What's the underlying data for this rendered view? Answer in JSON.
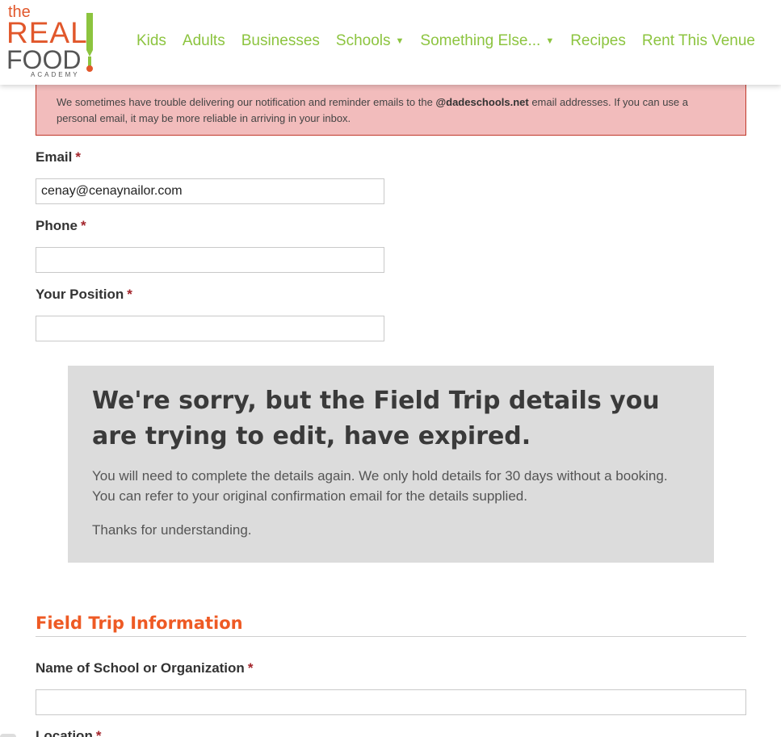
{
  "header": {
    "logo": {
      "the": "the",
      "real": "REAL",
      "food": "FOOD",
      "academy": "ACADEMY"
    },
    "nav": [
      {
        "label": "Kids",
        "dropdown": false
      },
      {
        "label": "Adults",
        "dropdown": false
      },
      {
        "label": "Businesses",
        "dropdown": false
      },
      {
        "label": "Schools",
        "dropdown": true
      },
      {
        "label": "Something Else...",
        "dropdown": true
      },
      {
        "label": "Recipes",
        "dropdown": false
      },
      {
        "label": "Rent This Venue",
        "dropdown": false
      }
    ],
    "nav_color": "#8cc43f"
  },
  "alert": {
    "text_before": "We sometimes have trouble delivering our notification and reminder emails to the ",
    "domain": "@dadeschools.net",
    "text_after": " email addresses. If you can use a personal email, it may be more reliable in arriving in your inbox."
  },
  "form": {
    "email": {
      "label": "Email",
      "required": "*",
      "value": "cenay@cenaynailor.com"
    },
    "phone": {
      "label": "Phone",
      "required": "*",
      "value": ""
    },
    "position": {
      "label": "Your Position",
      "required": "*",
      "value": ""
    }
  },
  "notice": {
    "heading": "We're sorry, but the Field Trip details you are trying to edit, have expired.",
    "body": "You will need to complete the details again. We only hold details for 30 days without a booking. You can refer to your original confirmation email for the details supplied.",
    "thanks": "Thanks for understanding."
  },
  "field_trip": {
    "section_title": "Field Trip Information",
    "school": {
      "label": "Name of School or Organization",
      "required": "*",
      "value": ""
    },
    "location": {
      "label": "Location",
      "required": "*"
    }
  },
  "colors": {
    "accent_orange": "#ee5a24",
    "required_red": "#a3242b",
    "alert_bg": "#f2bcbc"
  }
}
